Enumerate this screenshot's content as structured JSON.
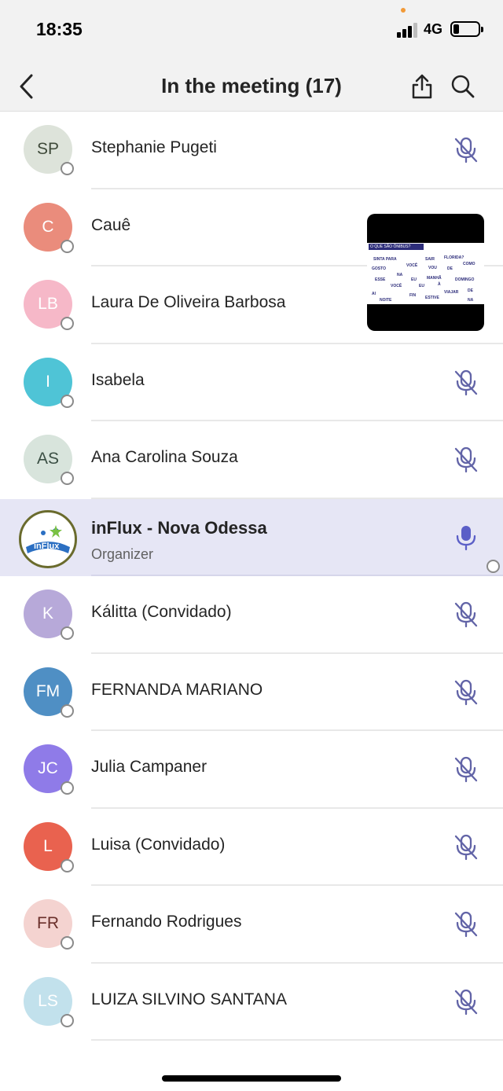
{
  "status_bar": {
    "time": "18:35",
    "network": "4G",
    "signal_bars": 3,
    "battery_level": 0.15
  },
  "header": {
    "title": "In the meeting (17)",
    "back_icon": "chevron-left-icon",
    "share_icon": "share-icon",
    "search_icon": "search-icon"
  },
  "participants": [
    {
      "initials": "SP",
      "name": "Stephanie Pugeti",
      "avatar_bg": "#dde3da",
      "avatar_fg": "#3f4a3a",
      "mic": "mic-off-icon"
    },
    {
      "initials": "C",
      "name": "Cauê",
      "avatar_bg": "#ea8c7c",
      "avatar_fg": "#ffffff",
      "mic": "mic-off-icon"
    },
    {
      "initials": "LB",
      "name": "Laura De Oliveira Barbosa",
      "avatar_bg": "#f6b8c8",
      "avatar_fg": "#ffffff",
      "mic": "mic-off-icon"
    },
    {
      "initials": "I",
      "name": "Isabela",
      "avatar_bg": "#4fc4d6",
      "avatar_fg": "#ffffff",
      "mic": "mic-off-icon"
    },
    {
      "initials": "AS",
      "name": "Ana Carolina Souza",
      "avatar_bg": "#d8e4dc",
      "avatar_fg": "#3b4f44",
      "mic": "mic-off-icon"
    },
    {
      "initials": "",
      "name": "inFlux - Nova Odessa",
      "subtitle": "Organizer",
      "avatar_bg": "#ffffff",
      "avatar_fg": "#ffffff",
      "mic": "mic-on-icon"
    },
    {
      "initials": "K",
      "name": "Kálitta (Convidado)",
      "avatar_bg": "#b7a9d9",
      "avatar_fg": "#ffffff",
      "mic": "mic-off-icon"
    },
    {
      "initials": "FM",
      "name": "FERNANDA MARIANO",
      "avatar_bg": "#4f8fc4",
      "avatar_fg": "#ffffff",
      "mic": "mic-off-icon"
    },
    {
      "initials": "JC",
      "name": "Julia Campaner",
      "avatar_bg": "#8f7be8",
      "avatar_fg": "#ffffff",
      "mic": "mic-off-icon"
    },
    {
      "initials": "L",
      "name": "Luisa (Convidado)",
      "avatar_bg": "#e9624f",
      "avatar_fg": "#ffffff",
      "mic": "mic-off-icon"
    },
    {
      "initials": "FR",
      "name": "Fernando Rodrigues",
      "avatar_bg": "#f4d3d0",
      "avatar_fg": "#6a2f2a",
      "mic": "mic-off-icon"
    },
    {
      "initials": "LS",
      "name": "LUIZA SILVINO SANTANA",
      "avatar_bg": "#c2e1ec",
      "avatar_fg": "#ffffff",
      "mic": "mic-off-icon"
    }
  ],
  "video_thumbnail": {
    "slide_title": "O QUE SÃO ÔNIBUS?",
    "words": [
      "GOSTO",
      "SINTA PARA",
      "VOCÊ",
      "SAIR",
      "VOU",
      "DE",
      "FLORIDA?",
      "COMO",
      "ESSE",
      "NA",
      "EU",
      "MANHÃ",
      "DOMINGO",
      "VOCÊ",
      "EU",
      "À",
      "VIAJAR",
      "DE",
      "AI",
      "NOITE",
      "FIN",
      "ESTIVE",
      "NA"
    ]
  },
  "colors": {
    "accent": "#5b5fc7",
    "highlight_row": "#e6e6f5",
    "mic_off": "#6264a7"
  }
}
